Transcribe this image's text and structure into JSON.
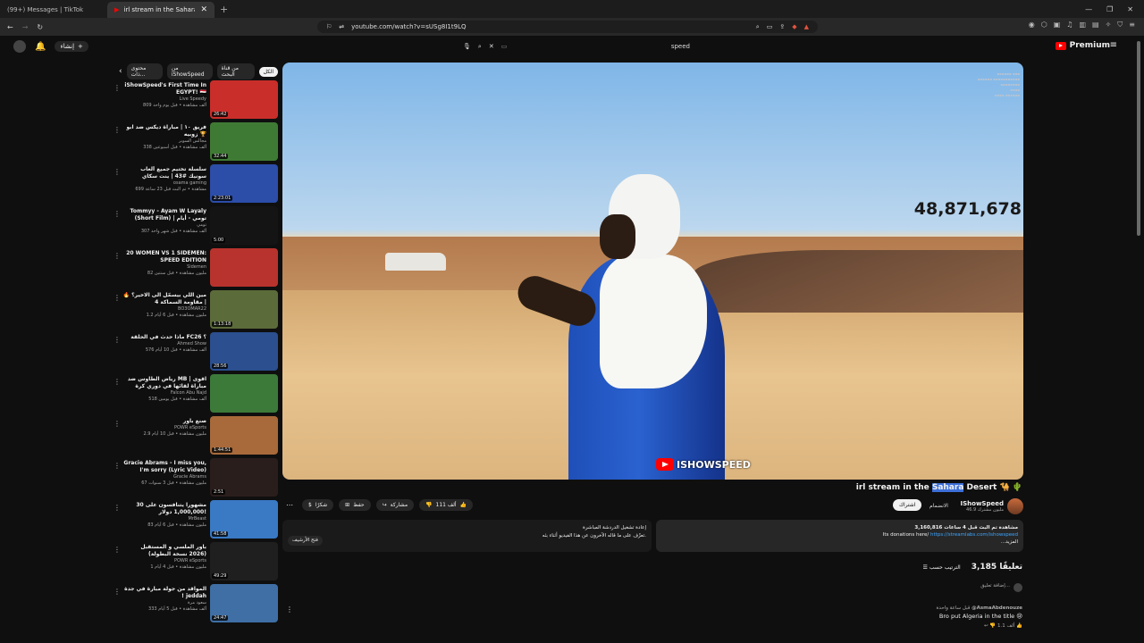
{
  "tabs": [
    {
      "label": "(99+) Messages | TikTok"
    },
    {
      "label": "irl stream in the Sahara Desert"
    }
  ],
  "address": {
    "url": "youtube.com/watch?v=sUSg8I1t9LQ"
  },
  "topbar": {
    "create_label": "إنشاء",
    "search_value": "speed",
    "premium_label": "Premium"
  },
  "chips": [
    {
      "label": "الكل"
    },
    {
      "label": "من قناة البحث"
    },
    {
      "label": "من iShowSpeed"
    },
    {
      "label": "محتوى ذات..."
    }
  ],
  "recs": [
    {
      "title": "iShowSpeed's First Time In EGYPT! 🇪🇬",
      "channel": "Live Speedy",
      "stats": "809 ألف مشاهدة • قبل يوم واحد",
      "duration": "26:42",
      "thumb": "#c92e2a"
    },
    {
      "title": "فريق ١٠ | مباراة ديكس ضد ابو زوبيه 🏆",
      "channel": "مجالس السوبر",
      "stats": "338 ألف مشاهدة • قبل أسبوعين",
      "duration": "32:44",
      "thumb": "#3f7a34"
    },
    {
      "title": "سلسلة تختيم جميع ألعاب سونيك #43 | ينت سكاي",
      "channel": "osama gaming",
      "stats": "699 مشاهدة • تم البث قبل 23 ساعة",
      "duration": "2:23:01",
      "thumb": "#2c4da8"
    },
    {
      "title": "Tommyy - Ayam W Layaly (Short Film) | تومي - أيام وليالي",
      "channel": "تومي",
      "stats": "307 ألف مشاهدة • قبل شهر واحد",
      "duration": "5:00",
      "thumb": "#141414"
    },
    {
      "title": "20 WOMEN VS 1 SIDEMEN: SPEED EDITION",
      "channel": "Sidemen",
      "stats": "82 مليون مشاهدة • قبل سنتين",
      "duration": "",
      "thumb": "#b8332d"
    },
    {
      "title": "مين اللي بيسمّل الى الاخير؟ 🔥 | مقاومة السماكة 4",
      "channel": "BO3OMAR22",
      "stats": "1.2 مليون مشاهدة • قبل 6 أيام",
      "duration": "1:13:18",
      "thumb": "#5c6b3a"
    },
    {
      "title": "ماذا حدث في الحلقة FC26 ؟",
      "channel": "Ahmed Show",
      "stats": "576 ألف مشاهدة • قبل 10 أيام",
      "duration": "28:56",
      "thumb": "#2b4f8f"
    },
    {
      "title": "رياض الطاوس ضد MB | اقوى مباراة لقائها في دوري كرة المدار",
      "channel": "Falcon Abu Najd",
      "stats": "518 ألف مشاهدة • قبل يومين",
      "duration": "",
      "thumb": "#3c7a3a"
    },
    {
      "title": "صنع باور",
      "channel": "POWR eSports",
      "stats": "2.9 مليون مشاهدة • قبل 10 أيام",
      "duration": "1:44:51",
      "thumb": "#a86a3a"
    },
    {
      "title": "Gracie Abrams - I miss you, I'm sorry (Lyric Video)",
      "channel": "Gracie Abrams",
      "stats": "67 مليون مشاهدة • قبل 3 سنوات",
      "duration": "2:51",
      "thumb": "#2a1e1c"
    },
    {
      "title": "30 مشهوراً يتنافسون على 1,000,000 دولار!",
      "channel": "MrBeast",
      "stats": "83 مليون مشاهدة • قبل 6 أيام",
      "duration": "41:58",
      "thumb": "#3a79c4"
    },
    {
      "title": "باور الملسي و المستقبل (2026 نسخة البطولة)",
      "channel": "POWR eSports",
      "stats": "1 مليون مشاهدة • قبل 4 أيام",
      "duration": "49:29",
      "thumb": "#1f1f1f"
    },
    {
      "title": "المواقد من جولة مبارة في جدة ! jeddah",
      "channel": "سعود مرة",
      "stats": "333 ألف مشاهدة • قبل 5 أيام",
      "duration": "24:47",
      "thumb": "#3f6fa5"
    }
  ],
  "player": {
    "viewer_overlay": "48,871,678",
    "watermark": "ISHOWSPEED"
  },
  "video": {
    "title_before": "irl stream in the ",
    "title_hl": "Sahara",
    "title_after": " Desert 🐪 🌵"
  },
  "channel": {
    "name": "IShowSpeed",
    "subs": "46.9 مليون مشترك",
    "join_label": "الانضمام",
    "subscribe_label": "اشتراك"
  },
  "actions": {
    "like_count": "111 ألف",
    "share_label": "مشاركة",
    "save_label": "حفظ",
    "thanks_label": "شكرًا"
  },
  "description": {
    "stats": "3,160,816 مشاهدة تم البث قبل 4 ساعات",
    "line2": "Its donations here/",
    "link": "https://streamlabs.com/ishowspeed",
    "more": "...المزيد"
  },
  "livechat": {
    "title": "إعادة تشغيل الدردشة المباشرة",
    "body": "تعرّف على ما قاله الآخرون عن هذا الفيديو أثناء بثه.",
    "open_label": "فتح الأرشيف"
  },
  "comments": {
    "count": "3,185 تعليقًا",
    "sort_label": "الترتيب حسب",
    "add_placeholder": "إضافة تعليق...",
    "first": {
      "user": "@AsmaAbdenouze",
      "time": "قبل ساعة واحدة",
      "text": "Bro put Algeria in the title 😢",
      "likes": "1.1 ألف"
    }
  }
}
